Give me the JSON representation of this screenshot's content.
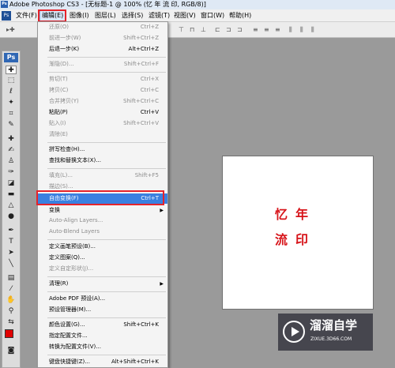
{
  "window": {
    "title": "Adobe Photoshop CS3 - [无标题-1 @ 100% (忆  年 流  印, RGB/8)]",
    "app_icon": "ps-icon"
  },
  "menubar": {
    "items": [
      "文件(F)",
      "编辑(E)",
      "图像(I)",
      "图层(L)",
      "选择(S)",
      "滤镜(T)",
      "视图(V)",
      "窗口(W)",
      "帮助(H)"
    ],
    "active": "编辑(E)"
  },
  "toolbox": {
    "logo": "Ps",
    "foreground_color": "#e00000"
  },
  "document": {
    "chars": [
      "忆",
      "年",
      "流",
      "印"
    ],
    "text_color": "#d7141a"
  },
  "edit_menu": {
    "items": [
      {
        "label": "还原(O)",
        "shortcut": "Ctrl+Z",
        "disabled": true
      },
      {
        "label": "前进一步(W)",
        "shortcut": "Shift+Ctrl+Z",
        "disabled": true
      },
      {
        "label": "后退一步(K)",
        "shortcut": "Alt+Ctrl+Z",
        "disabled": false
      },
      {
        "label": "渐隐(D)...",
        "shortcut": "Shift+Ctrl+F",
        "disabled": true
      },
      {
        "label": "剪切(T)",
        "shortcut": "Ctrl+X",
        "disabled": true
      },
      {
        "label": "拷贝(C)",
        "shortcut": "Ctrl+C",
        "disabled": true
      },
      {
        "label": "合并拷贝(Y)",
        "shortcut": "Shift+Ctrl+C",
        "disabled": true
      },
      {
        "label": "粘贴(P)",
        "shortcut": "Ctrl+V",
        "disabled": false
      },
      {
        "label": "贴入(I)",
        "shortcut": "Shift+Ctrl+V",
        "disabled": true
      },
      {
        "label": "清除(E)",
        "shortcut": "",
        "disabled": true
      },
      {
        "label": "拼写检查(H)...",
        "shortcut": "",
        "disabled": false
      },
      {
        "label": "查找和替换文本(X)...",
        "shortcut": "",
        "disabled": false
      },
      {
        "label": "填充(L)...",
        "shortcut": "Shift+F5",
        "disabled": true
      },
      {
        "label": "描边(S)...",
        "shortcut": "",
        "disabled": true
      },
      {
        "label": "自由变换(F)",
        "shortcut": "Ctrl+T",
        "disabled": false,
        "highlighted": true
      },
      {
        "label": "变换",
        "shortcut": "",
        "disabled": false,
        "submenu": true
      },
      {
        "label": "Auto-Align Layers...",
        "shortcut": "",
        "disabled": true
      },
      {
        "label": "Auto-Blend Layers",
        "shortcut": "",
        "disabled": true
      },
      {
        "label": "定义画笔预设(B)...",
        "shortcut": "",
        "disabled": false
      },
      {
        "label": "定义图案(Q)...",
        "shortcut": "",
        "disabled": false
      },
      {
        "label": "定义自定形状(J)...",
        "shortcut": "",
        "disabled": true
      },
      {
        "label": "清理(R)",
        "shortcut": "",
        "disabled": false,
        "submenu": true
      },
      {
        "label": "Adobe PDF 预设(A)...",
        "shortcut": "",
        "disabled": false
      },
      {
        "label": "预设管理器(M)...",
        "shortcut": "",
        "disabled": false
      },
      {
        "label": "颜色设置(G)...",
        "shortcut": "Shift+Ctrl+K",
        "disabled": false
      },
      {
        "label": "指定配置文件...",
        "shortcut": "",
        "disabled": false
      },
      {
        "label": "转换为配置文件(V)...",
        "shortcut": "",
        "disabled": false
      },
      {
        "label": "键盘快捷键(Z)...",
        "shortcut": "Alt+Shift+Ctrl+K",
        "disabled": false
      }
    ]
  },
  "watermark": {
    "title": "溜溜自学",
    "url": "ZIXUE.3D66.COM"
  }
}
